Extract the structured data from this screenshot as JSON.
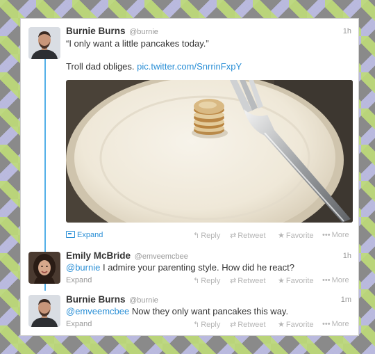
{
  "thread": {
    "tweets": [
      {
        "name": "Burnie Burns",
        "handle": "@burnie",
        "time": "1h",
        "text_line1": "“I only want a little pancakes today.”",
        "text_line2": "Troll dad obliges.",
        "link": "pic.twitter.com/SnrrinFxpY",
        "expand_label": "Expand",
        "avatar_icon": "person-avatar-bearded-man"
      },
      {
        "name": "Emily McBride",
        "handle": "@emveemcbee",
        "time": "1h",
        "mention": "@burnie",
        "text": "I admire your parenting style. How did he react?",
        "expand_label": "Expand",
        "avatar_icon": "person-avatar-woman"
      },
      {
        "name": "Burnie Burns",
        "handle": "@burnie",
        "time": "1m",
        "mention": "@emveemcbee",
        "text": "Now they only want pancakes this way.",
        "expand_label": "Expand",
        "avatar_icon": "person-avatar-bearded-man"
      }
    ]
  },
  "actions": {
    "reply": "Reply",
    "retweet": "Retweet",
    "favorite": "Favorite",
    "more": "More"
  },
  "colors": {
    "link": "#2a8fd6",
    "thread_line": "#55b0e8",
    "border_green": "#bedc78",
    "border_lavender": "#bebee6"
  }
}
